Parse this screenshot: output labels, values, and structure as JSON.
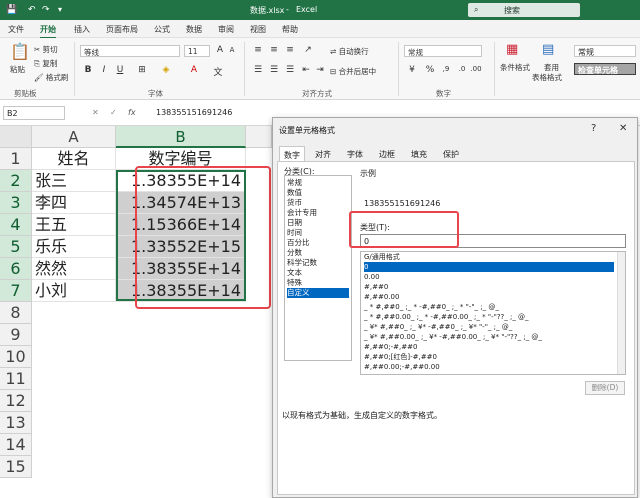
{
  "titlebar": {
    "autosave_icon": "save-icon",
    "filename": "数据.xlsx",
    "separator": "-",
    "app": "Excel",
    "search": "搜索"
  },
  "menus": [
    "文件",
    "开始",
    "插入",
    "页面布局",
    "公式",
    "数据",
    "审阅",
    "视图",
    "帮助"
  ],
  "ribbon": {
    "paste": "粘贴",
    "cut": "剪切",
    "copy": "复制",
    "format_painter": "格式刷",
    "clipboard_group": "剪贴板",
    "font_name": "等线",
    "font_size": "11",
    "font_group": "字体",
    "wrap_text": "自动换行",
    "merge_center": "合并后居中",
    "align_group": "对齐方式",
    "number_format": "常规",
    "number_group": "数字",
    "conditional_format": "条件格式",
    "table_format_1": "套用",
    "table_format_2": "表格格式",
    "style_normal": "常规",
    "style_check": "检查单元格"
  },
  "formula_bar": {
    "name_box": "B2",
    "cancel": "✕",
    "enter": "✓",
    "fx": "fx",
    "value": "138355151691246"
  },
  "grid": {
    "columns": [
      "A",
      "B"
    ],
    "rows": [
      "1",
      "2",
      "3",
      "4",
      "5",
      "6",
      "7",
      "8",
      "9",
      "10",
      "11",
      "12",
      "13",
      "14",
      "15"
    ],
    "header_row": {
      "a": "姓名",
      "b": "数字编号"
    },
    "data": [
      {
        "a": "张三",
        "b": "1.38355E+14"
      },
      {
        "a": "李四",
        "b": "1.34574E+13"
      },
      {
        "a": "王五",
        "b": "1.15366E+14"
      },
      {
        "a": "乐乐",
        "b": "1.33552E+15"
      },
      {
        "a": "然然",
        "b": "1.38355E+14"
      },
      {
        "a": "小刘",
        "b": "1.38355E+14"
      }
    ]
  },
  "dialog": {
    "title": "设置单元格格式",
    "help": "?",
    "close": "✕",
    "tabs": [
      "数字",
      "对齐",
      "字体",
      "边框",
      "填充",
      "保护"
    ],
    "category_label": "分类(C):",
    "categories": [
      "常规",
      "数值",
      "货币",
      "会计专用",
      "日期",
      "时间",
      "百分比",
      "分数",
      "科学记数",
      "文本",
      "特殊",
      "自定义"
    ],
    "selected_category": "自定义",
    "sample_label": "示例",
    "sample_value": "138355151691246",
    "type_label": "类型(T):",
    "type_value": "0",
    "formats": [
      "G/通用格式",
      "0",
      "0.00",
      "#,##0",
      "#,##0.00",
      "_ * #,##0_ ;_ * -#,##0_ ;_ * \"-\"_ ;_ @_",
      "_ * #,##0.00_ ;_ * -#,##0.00_ ;_ * \"-\"??_ ;_ @_",
      "_ ¥* #,##0_ ;_ ¥* -#,##0_ ;_ ¥* \"-\"_ ;_ @_",
      "_ ¥* #,##0.00_ ;_ ¥* -#,##0.00_ ;_ ¥* \"-\"??_ ;_ @_",
      "#,##0;-#,##0",
      "#,##0;[红色]-#,##0",
      "#,##0.00;-#,##0.00"
    ],
    "selected_format": "0",
    "delete_button": "删除(D)",
    "description": "以现有格式为基础，生成自定义的数字格式。"
  },
  "colors": {
    "excel_green": "#217346",
    "highlight_red": "#e8454b",
    "selection_blue": "#0067c0"
  }
}
